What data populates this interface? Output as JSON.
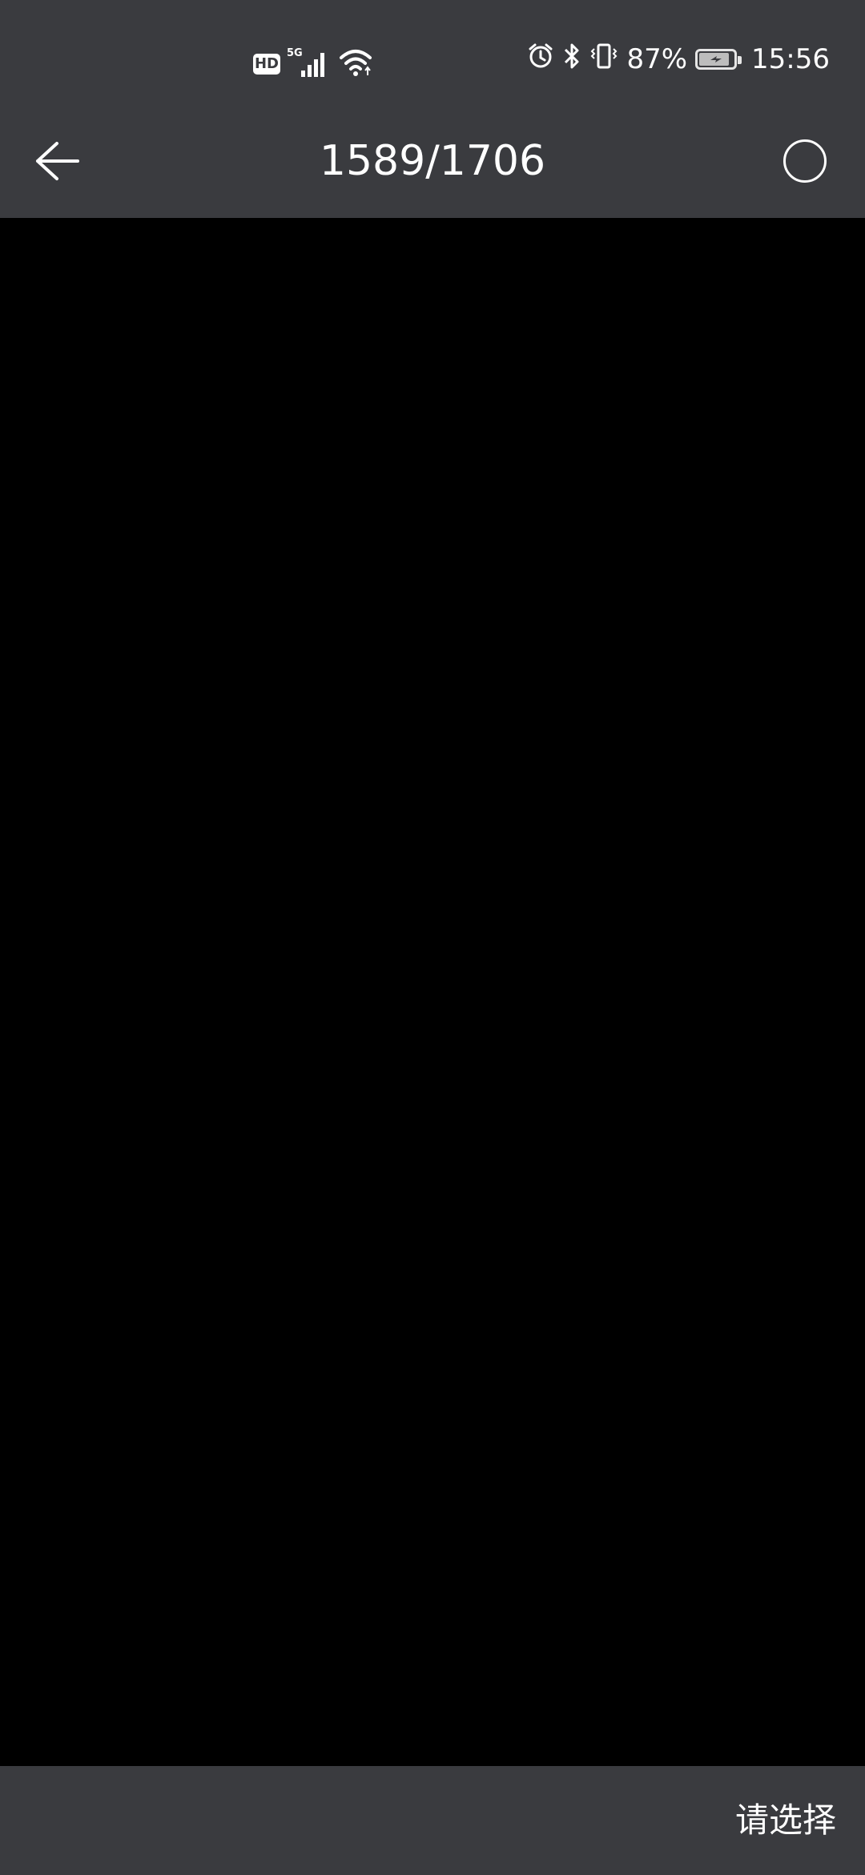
{
  "status_bar": {
    "network_badge": "HD",
    "network_type": "5G",
    "battery_percent": "87%",
    "battery_level": 0.87,
    "time": "15:56",
    "icons": [
      "hd-icon",
      "signal-5g-icon",
      "wifi-icon",
      "alarm-icon",
      "bluetooth-icon",
      "vibrate-icon",
      "battery-charging-icon"
    ]
  },
  "header": {
    "counter": "1589/1706",
    "back_icon": "arrow-left-icon",
    "select_icon": "circle-select-icon"
  },
  "bottom_bar": {
    "choose_label": "请选择"
  },
  "colors": {
    "bar_background": "#3a3b3f",
    "viewer_background": "#000000",
    "foreground": "#ffffff"
  }
}
